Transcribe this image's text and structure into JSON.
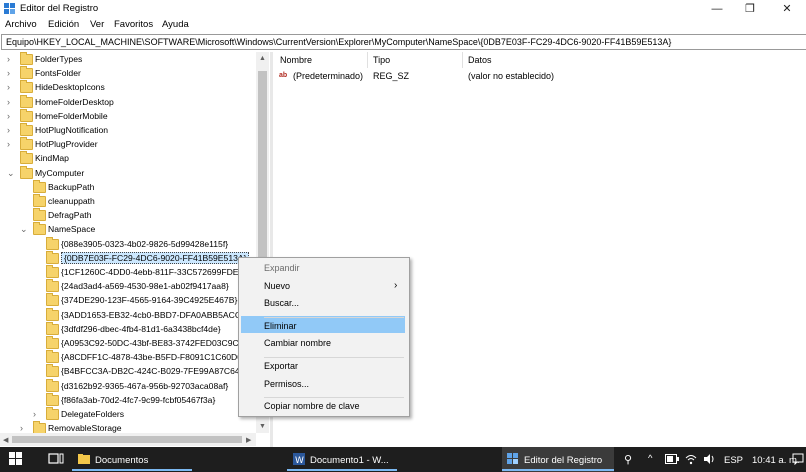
{
  "window": {
    "title": "Editor del Registro",
    "minimize_glyph": "—",
    "maximize_glyph": "❐",
    "close_glyph": "✕"
  },
  "menu": {
    "items": [
      "Archivo",
      "Edición",
      "Ver",
      "Favoritos",
      "Ayuda"
    ]
  },
  "address": {
    "path": "Equipo\\HKEY_LOCAL_MACHINE\\SOFTWARE\\Microsoft\\Windows\\CurrentVersion\\Explorer\\MyComputer\\NameSpace\\{0DB7E03F-FC29-4DC6-9020-FF41B59E513A}"
  },
  "tree": {
    "expand_glyph": "›",
    "collapse_glyph": "⌄",
    "rows": [
      {
        "label": "FolderTypes",
        "level": 0,
        "state": "collapsed"
      },
      {
        "label": "FontsFolder",
        "level": 0,
        "state": "collapsed"
      },
      {
        "label": "HideDesktopIcons",
        "level": 0,
        "state": "collapsed"
      },
      {
        "label": "HomeFolderDesktop",
        "level": 0,
        "state": "collapsed"
      },
      {
        "label": "HomeFolderMobile",
        "level": 0,
        "state": "collapsed"
      },
      {
        "label": "HotPlugNotification",
        "level": 0,
        "state": "collapsed"
      },
      {
        "label": "HotPlugProvider",
        "level": 0,
        "state": "collapsed"
      },
      {
        "label": "KindMap",
        "level": 0,
        "state": "none"
      },
      {
        "label": "MyComputer",
        "level": 0,
        "state": "expanded"
      },
      {
        "label": "BackupPath",
        "level": 1,
        "state": "none"
      },
      {
        "label": "cleanuppath",
        "level": 1,
        "state": "none"
      },
      {
        "label": "DefragPath",
        "level": 1,
        "state": "none"
      },
      {
        "label": "NameSpace",
        "level": 1,
        "state": "expanded"
      },
      {
        "label": "{088e3905-0323-4b02-9826-5d99428e115f}",
        "level": 2,
        "state": "none"
      },
      {
        "label": "{0DB7E03F-FC29-4DC6-9020-FF41B59E513A}",
        "level": 2,
        "state": "none",
        "selected": true
      },
      {
        "label": "{1CF1260C-4DD0-4ebb-811F-33C572699FDE}",
        "level": 2,
        "state": "none"
      },
      {
        "label": "{24ad3ad4-a569-4530-98e1-ab02f9417aa8}",
        "level": 2,
        "state": "none"
      },
      {
        "label": "{374DE290-123F-4565-9164-39C4925E467B}",
        "level": 2,
        "state": "none"
      },
      {
        "label": "{3ADD1653-EB32-4cb0-BBD7-DFA0ABB5ACCA}",
        "level": 2,
        "state": "none"
      },
      {
        "label": "{3dfdf296-dbec-4fb4-81d1-6a3438bcf4de}",
        "level": 2,
        "state": "none"
      },
      {
        "label": "{A0953C92-50DC-43bf-BE83-3742FED03C9C}",
        "level": 2,
        "state": "none"
      },
      {
        "label": "{A8CDFF1C-4878-43be-B5FD-F8091C1C60D0}",
        "level": 2,
        "state": "none"
      },
      {
        "label": "{B4BFCC3A-DB2C-424C-B029-7FE99A87C641}",
        "level": 2,
        "state": "none"
      },
      {
        "label": "{d3162b92-9365-467a-956b-92703aca08af}",
        "level": 2,
        "state": "none"
      },
      {
        "label": "{f86fa3ab-70d2-4fc7-9c99-fcbf05467f3a}",
        "level": 2,
        "state": "none"
      },
      {
        "label": "DelegateFolders",
        "level": 2,
        "state": "collapsed"
      },
      {
        "label": "RemovableStorage",
        "level": 1,
        "state": "collapsed"
      }
    ]
  },
  "list": {
    "columns": {
      "name": "Nombre",
      "type": "Tipo",
      "data": "Datos"
    },
    "rows": [
      {
        "name": "(Predeterminado)",
        "type": "REG_SZ",
        "data": "(valor no establecido)",
        "icon_text": "ab"
      }
    ]
  },
  "context_menu": {
    "items": [
      {
        "label": "Expandir",
        "disabled": true
      },
      {
        "label": "Nuevo",
        "submenu": true,
        "submenu_glyph": "›"
      },
      {
        "label": "Buscar..."
      },
      {
        "separator": true
      },
      {
        "label": "Eliminar",
        "highlighted": true
      },
      {
        "label": "Cambiar nombre"
      },
      {
        "separator": true
      },
      {
        "label": "Exportar"
      },
      {
        "label": "Permisos..."
      },
      {
        "separator": true
      },
      {
        "label": "Copiar nombre de clave"
      }
    ]
  },
  "taskbar": {
    "documentos": "Documentos",
    "word": "Documento1 - W...",
    "regedit": "Editor del Registro",
    "lang": "ESP",
    "time": "10:41 a. m."
  },
  "colors": {
    "accent": "#0078d7",
    "highlight": "#91c9f7",
    "selection": "#cce8ff",
    "folder": "#f6d36a",
    "taskbar": "#1e1e1e"
  }
}
